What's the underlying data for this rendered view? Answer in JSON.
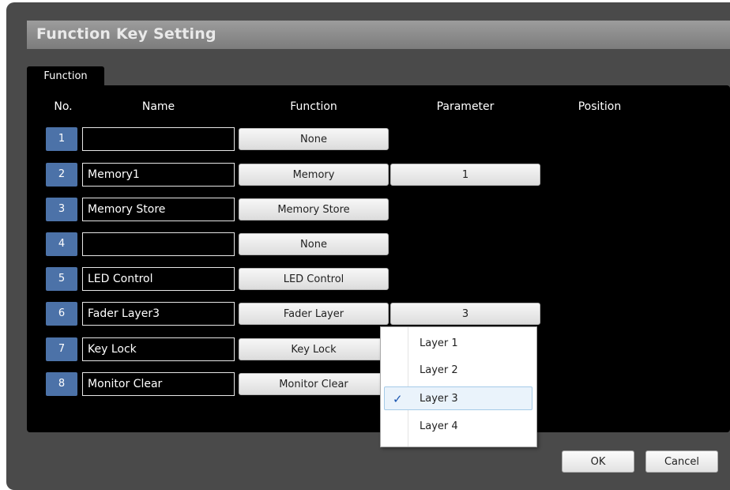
{
  "window": {
    "title": "Function Key Setting"
  },
  "tab": {
    "label": "Function"
  },
  "headers": {
    "no": "No.",
    "name": "Name",
    "function": "Function",
    "parameter": "Parameter",
    "position": "Position"
  },
  "rows": [
    {
      "no": "1",
      "name": "",
      "function": "None",
      "parameter": null
    },
    {
      "no": "2",
      "name": "Memory1",
      "function": "Memory",
      "parameter": "1"
    },
    {
      "no": "3",
      "name": "Memory Store",
      "function": "Memory Store",
      "parameter": null
    },
    {
      "no": "4",
      "name": "",
      "function": "None",
      "parameter": null
    },
    {
      "no": "5",
      "name": "LED Control",
      "function": "LED Control",
      "parameter": null
    },
    {
      "no": "6",
      "name": "Fader Layer3",
      "function": "Fader Layer",
      "parameter": "3"
    },
    {
      "no": "7",
      "name": "Key Lock",
      "function": "Key Lock",
      "parameter": null
    },
    {
      "no": "8",
      "name": "Monitor Clear",
      "function": "Monitor Clear",
      "parameter": null
    }
  ],
  "dropdown": {
    "items": [
      "Layer 1",
      "Layer 2",
      "Layer 3",
      "Layer 4"
    ],
    "selected_index": 2
  },
  "buttons": {
    "ok": "OK",
    "cancel": "Cancel"
  },
  "colors": {
    "number_badge": "#4c72a8",
    "window_bg": "#4a4a4a",
    "panel_bg": "#000000"
  }
}
